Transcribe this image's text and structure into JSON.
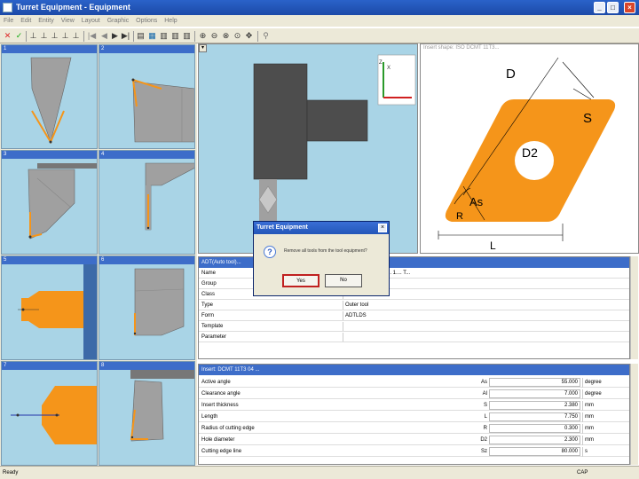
{
  "window": {
    "title": "Turret Equipment - Equipment",
    "minimize": "_",
    "maximize": "□",
    "close": "×"
  },
  "menu": [
    "File",
    "Edit",
    "Entity",
    "View",
    "Layout",
    "Graphic",
    "Options",
    "Help"
  ],
  "toolbar_icons": [
    "delete-icon",
    "check-icon",
    "tool1-icon",
    "tool2-icon",
    "tool3-icon",
    "tool4-icon",
    "tool5-icon",
    "first-icon",
    "prev-icon",
    "next-icon",
    "last-icon",
    "list-icon",
    "grid-icon",
    "tile1-icon",
    "tile2-icon",
    "tile3-icon",
    "zoom-in-icon",
    "zoom-out-icon",
    "zoom-fit-icon",
    "zoom-window-icon",
    "pan-icon",
    "info-icon"
  ],
  "tiles": [
    {
      "num": "1"
    },
    {
      "num": "2"
    },
    {
      "num": "3"
    },
    {
      "num": "4"
    },
    {
      "num": "5"
    },
    {
      "num": "6"
    },
    {
      "num": "7"
    },
    {
      "num": "8"
    }
  ],
  "preview": {
    "dropdown": "▾",
    "axis_x": "X",
    "axis_z": "Z"
  },
  "insert_image": {
    "header": "Insert shape: ISO DCMT 11T3...",
    "labels": {
      "D": "D",
      "S": "S",
      "D2": "D2",
      "As": "As",
      "R": "R",
      "L": "L"
    },
    "colors": {
      "insert": "#f5951a",
      "line": "#000000"
    }
  },
  "tool_props": {
    "header": "ADT(Auto tool)...",
    "rows": [
      {
        "label": "Name",
        "value": "ADTLDSR 0... E3... 1.... T..."
      },
      {
        "label": "Group",
        "value": ""
      },
      {
        "label": "Class",
        "value": ""
      },
      {
        "label": "Type",
        "value": "Outer tool"
      },
      {
        "label": "Form",
        "value": "ADTLDS"
      },
      {
        "label": "Template",
        "value": ""
      },
      {
        "label": "Parameter",
        "value": ""
      }
    ]
  },
  "insert_props": {
    "header": "Insert: DCMT 11T3 04 ...",
    "rows": [
      {
        "label": "Active angle",
        "sym": "As",
        "num": "55.000",
        "unit": "degree"
      },
      {
        "label": "Clearance angle",
        "sym": "Al",
        "num": "7.000",
        "unit": "degree"
      },
      {
        "label": "Insert thickness",
        "sym": "S",
        "num": "2.380",
        "unit": "mm"
      },
      {
        "label": "Length",
        "sym": "L",
        "num": "7.750",
        "unit": "mm"
      },
      {
        "label": "Radius of cutting edge",
        "sym": "R",
        "num": "0.300",
        "unit": "mm"
      },
      {
        "label": "Hole diameter",
        "sym": "D2",
        "num": "2.300",
        "unit": "mm"
      },
      {
        "label": "Cutting edge line",
        "sym": "Sz",
        "num": "80.000",
        "unit": "s"
      }
    ]
  },
  "dialog": {
    "title": "Turret Equipment",
    "message": "Remove all tools from the tool equipment?",
    "yes": "Yes",
    "no": "No",
    "close": "×",
    "icon": "?"
  },
  "status": {
    "left": "Ready",
    "right": "CAP"
  }
}
